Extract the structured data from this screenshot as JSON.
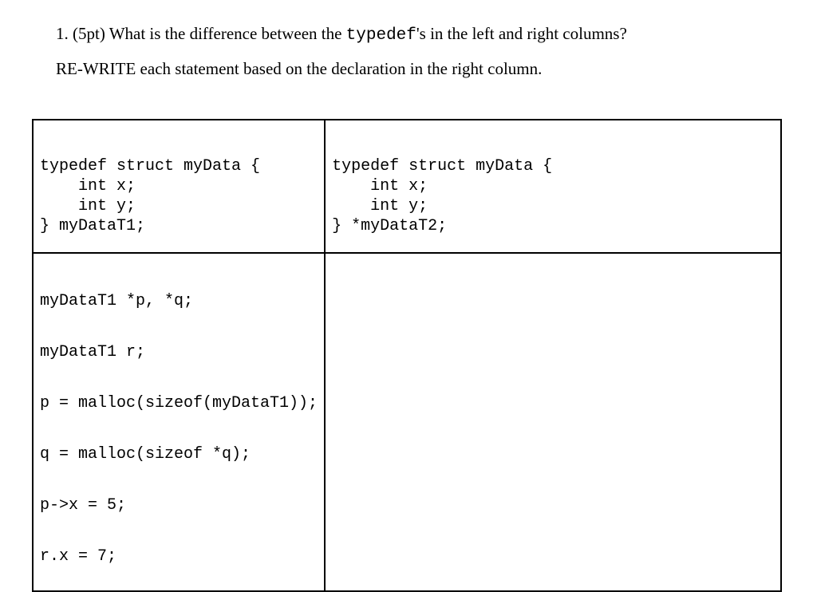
{
  "question": {
    "number_points": "1. (5pt) What is  the difference between the ",
    "code_word": "typedef",
    "after_code": "'s in the left and right columns?",
    "instruction": "RE-WRITE each statement based on the declaration in the right column."
  },
  "table": {
    "top_left": {
      "l1": "typedef struct myData {",
      "l2": "    int x;",
      "l3": "    int y;",
      "l4": "} myDataT1;"
    },
    "top_right": {
      "l1": "typedef struct myData {",
      "l2": "    int x;",
      "l3": "    int y;",
      "l4": "} *myDataT2;"
    },
    "bottom_left": {
      "s1": "myDataT1 *p, *q;",
      "s2": "myDataT1 r;",
      "s3": "p = malloc(sizeof(myDataT1));",
      "s4": "q = malloc(sizeof *q);",
      "s5": "p->x = 5;",
      "s6": "r.x = 7;"
    },
    "bottom_right": ""
  }
}
